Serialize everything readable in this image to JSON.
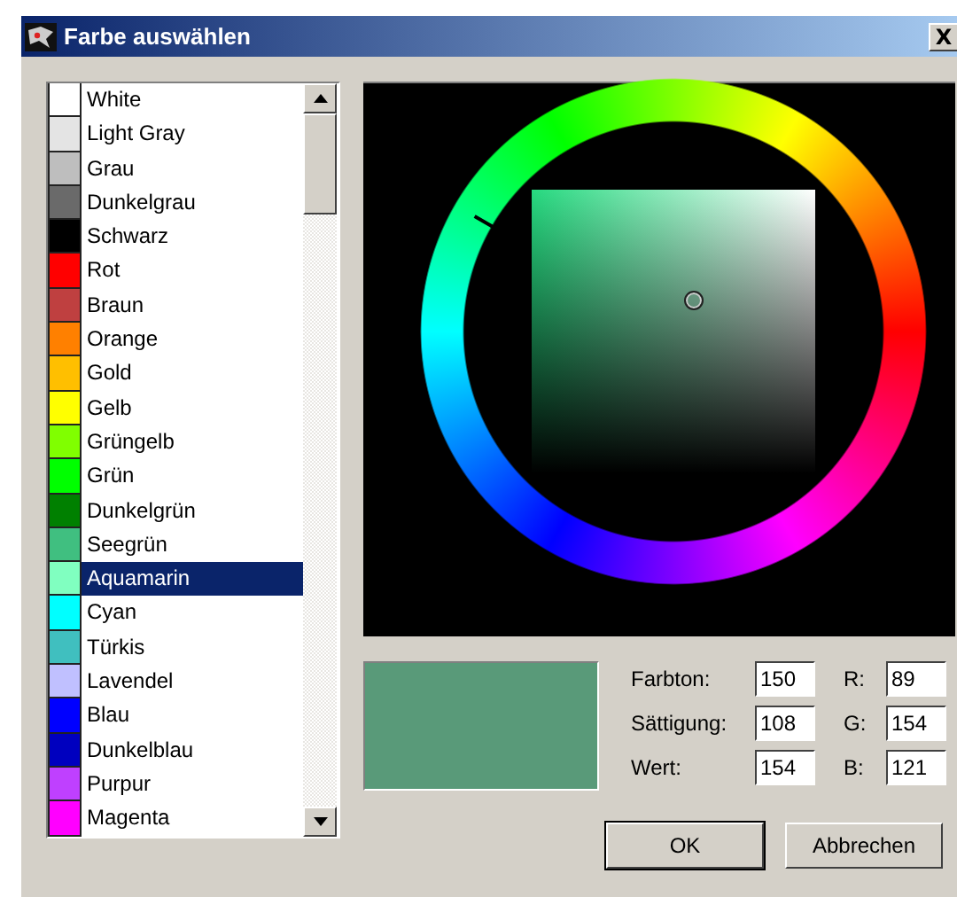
{
  "window": {
    "title": "Farbe auswählen",
    "close_label": "X"
  },
  "colors": [
    {
      "name": "White",
      "color": "#ffffff",
      "selected": false
    },
    {
      "name": "Light Gray",
      "color": "#e4e4e4",
      "selected": false
    },
    {
      "name": "Grau",
      "color": "#bebebe",
      "selected": false
    },
    {
      "name": "Dunkelgrau",
      "color": "#6a6a6a",
      "selected": false
    },
    {
      "name": "Schwarz",
      "color": "#000000",
      "selected": false
    },
    {
      "name": "Rot",
      "color": "#ff0000",
      "selected": false
    },
    {
      "name": "Braun",
      "color": "#bf4040",
      "selected": false
    },
    {
      "name": "Orange",
      "color": "#ff8000",
      "selected": false
    },
    {
      "name": "Gold",
      "color": "#ffbf00",
      "selected": false
    },
    {
      "name": "Gelb",
      "color": "#ffff00",
      "selected": false
    },
    {
      "name": "Grüngelb",
      "color": "#80ff00",
      "selected": false
    },
    {
      "name": "Grün",
      "color": "#00ff00",
      "selected": false
    },
    {
      "name": "Dunkelgrün",
      "color": "#008000",
      "selected": false
    },
    {
      "name": "Seegrün",
      "color": "#40bf80",
      "selected": false
    },
    {
      "name": "Aquamarin",
      "color": "#80ffc0",
      "selected": true
    },
    {
      "name": "Cyan",
      "color": "#00ffff",
      "selected": false
    },
    {
      "name": "Türkis",
      "color": "#40bfbf",
      "selected": false
    },
    {
      "name": "Lavendel",
      "color": "#c0c0ff",
      "selected": false
    },
    {
      "name": "Blau",
      "color": "#0000ff",
      "selected": false
    },
    {
      "name": "Dunkelblau",
      "color": "#0000bf",
      "selected": false
    },
    {
      "name": "Purpur",
      "color": "#bf40ff",
      "selected": false
    },
    {
      "name": "Magenta",
      "color": "#ff00ff",
      "selected": false
    }
  ],
  "hsv": [
    {
      "label": "Farbton:",
      "value": "150"
    },
    {
      "label": "Sättigung:",
      "value": "108"
    },
    {
      "label": "Wert:",
      "value": "154"
    }
  ],
  "rgb": [
    {
      "label": "R:",
      "value": "89"
    },
    {
      "label": "G:",
      "value": "154"
    },
    {
      "label": "B:",
      "value": "121"
    }
  ],
  "buttons": [
    {
      "label": "OK",
      "default": true
    },
    {
      "label": "Abbrechen",
      "default": false
    }
  ]
}
